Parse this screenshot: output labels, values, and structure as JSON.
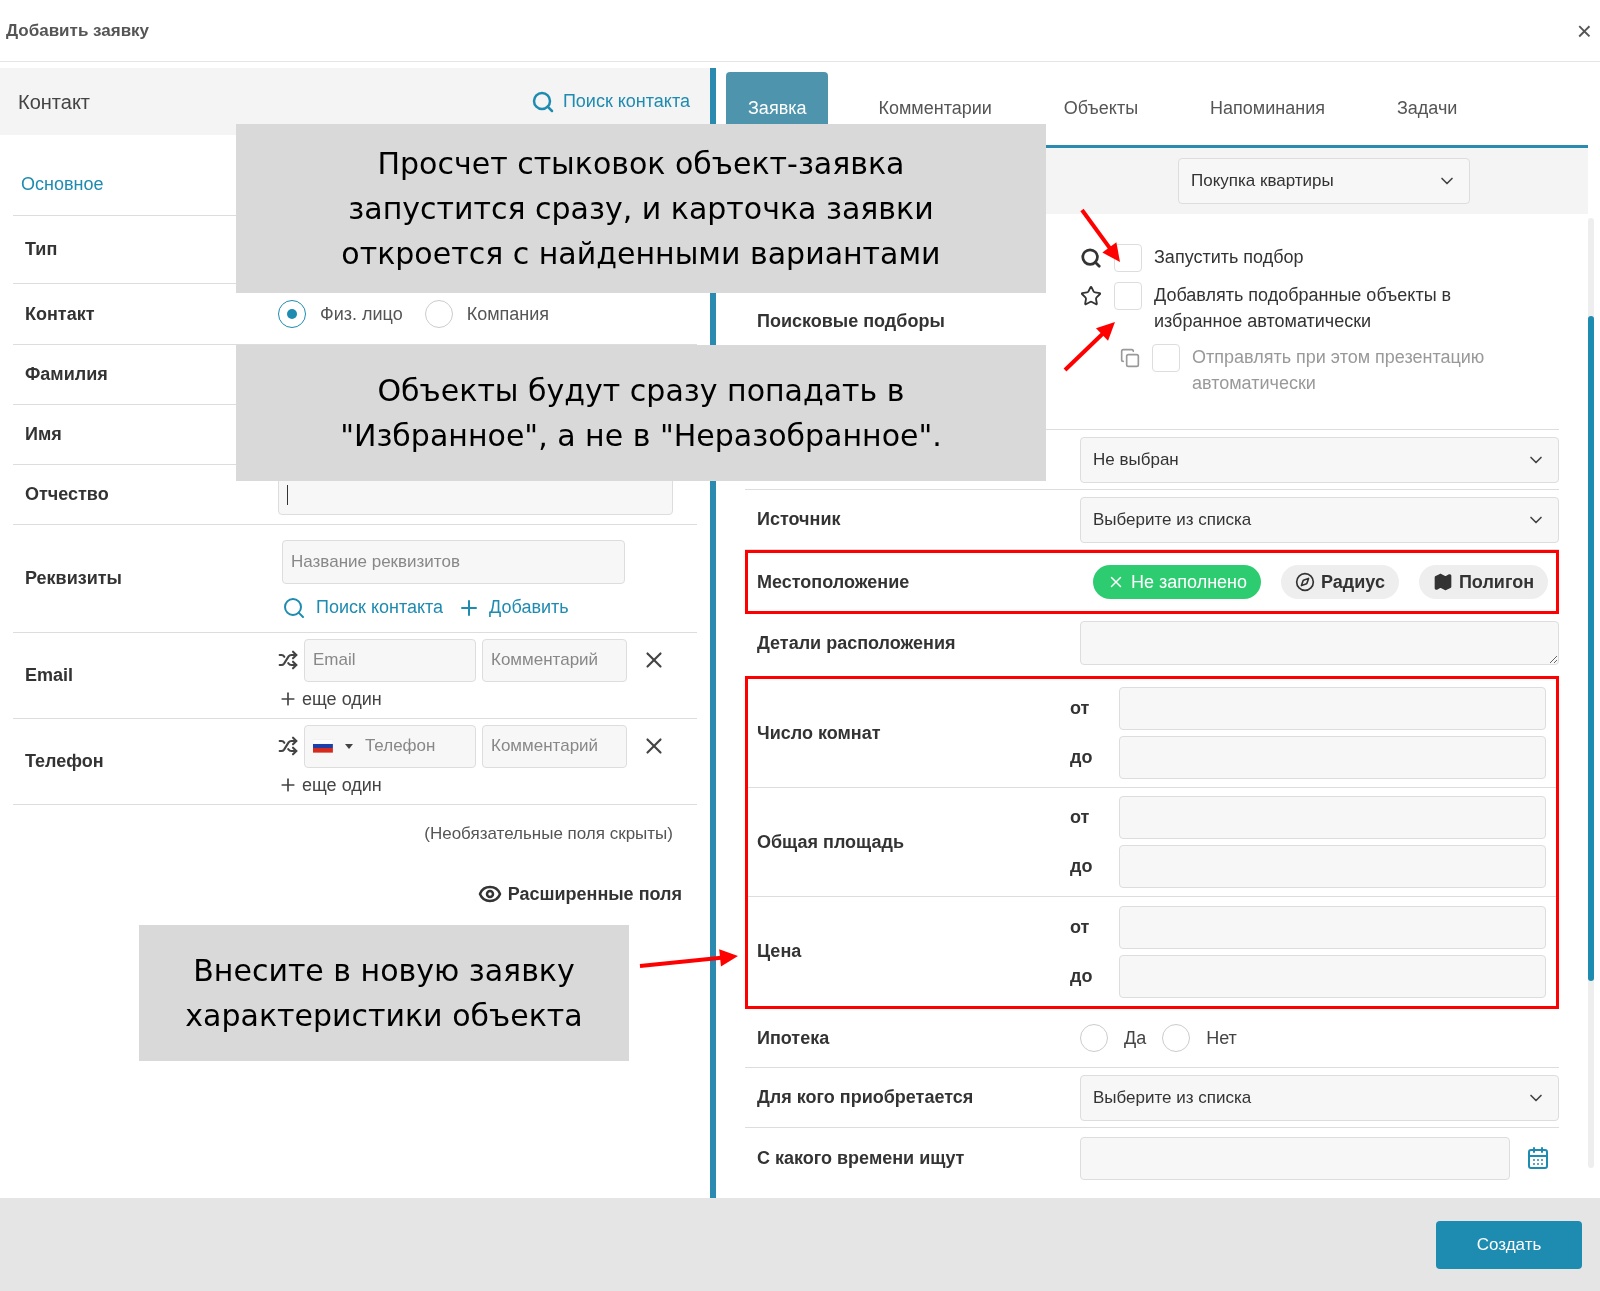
{
  "dialog": {
    "title": "Добавить заявку",
    "close": "×"
  },
  "contact_panel": {
    "title": "Контакт",
    "search_link": "Поиск контакта",
    "section": "Основное",
    "type_label": "Тип",
    "contact": {
      "label": "Контакт",
      "options": [
        {
          "label": "Физ. лицо",
          "selected": true
        },
        {
          "label": "Компания",
          "selected": false
        }
      ]
    },
    "surname_label": "Фамилия",
    "name_label": "Имя",
    "patronymic": {
      "label": "Отчество",
      "focused": true
    },
    "requisites": {
      "label": "Реквизиты",
      "placeholder": "Название реквизитов",
      "search_link": "Поиск контакта",
      "add_link": "Добавить"
    },
    "email": {
      "label": "Email",
      "placeholder": "Email",
      "comment_placeholder": "Комментарий",
      "more": "еще один"
    },
    "phone": {
      "label": "Телефон",
      "placeholder": "Телефон",
      "comment_placeholder": "Комментарий",
      "more": "еще один"
    },
    "hidden_note": "(Необязательные поля скрыты)",
    "extended_link": "Расширенные поля"
  },
  "request_panel": {
    "tabs": [
      {
        "label": "Заявка",
        "selected": true
      },
      {
        "label": "Комментарии",
        "selected": false
      },
      {
        "label": "Объекты",
        "selected": false
      },
      {
        "label": "Напоминания",
        "selected": false
      },
      {
        "label": "Задачи",
        "selected": false
      }
    ],
    "type_select": "Покупка квартиры",
    "search_label": "Поисковые подборы",
    "search_options": [
      {
        "label": "Запустить подбор",
        "checked": false,
        "disabled": false
      },
      {
        "label": "Добавлять подобранные объекты в избранное автоматически",
        "checked": false,
        "disabled": false
      },
      {
        "label": "Отправлять при этом презентацию автоматически",
        "checked": false,
        "disabled": true
      }
    ],
    "status_select": "Не выбран",
    "source": {
      "label": "Источник",
      "value": "Выберите из списка"
    },
    "location": {
      "label": "Местоположение",
      "highlighted": true,
      "modes": [
        {
          "label": "Не заполнено",
          "selected": true
        },
        {
          "label": "Радиус",
          "selected": false
        },
        {
          "label": "Полигон",
          "selected": false
        }
      ]
    },
    "location_details": {
      "label": "Детали расположения"
    },
    "ranges_highlighted": true,
    "ranges": [
      {
        "label": "Число комнат",
        "from": "от",
        "to": "до"
      },
      {
        "label": "Общая площадь",
        "from": "от",
        "to": "до"
      },
      {
        "label": "Цена",
        "from": "от",
        "to": "до"
      }
    ],
    "mortgage": {
      "label": "Ипотека",
      "options": [
        {
          "label": "Да",
          "selected": false
        },
        {
          "label": "Нет",
          "selected": false
        }
      ]
    },
    "buyer": {
      "label": "Для кого приобретается",
      "value": "Выберите из списка"
    },
    "since": {
      "label": "С какого времени ищут"
    }
  },
  "footer": {
    "create": "Создать"
  },
  "callouts": [
    {
      "text": "Просчет стыковок объект-заявка\nзапустится сразу, и карточка заявки\nоткроется с найденными вариантами"
    },
    {
      "text": "Объекты будут сразу попадать в\n\"Избранное\", а не в \"Неразобранное\"."
    },
    {
      "text": "Внесите в новую заявку\nхарактеристики объекта"
    }
  ]
}
